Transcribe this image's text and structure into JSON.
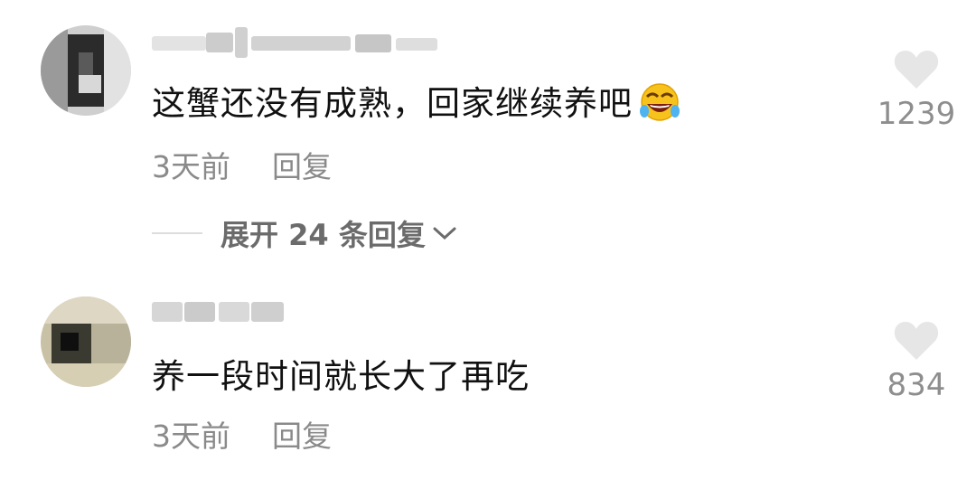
{
  "comments": [
    {
      "text": "这蟹还没有成熟，回家继续养吧",
      "emoji": "rolling-laughing-emoji",
      "time": "3天前",
      "reply_label": "回复",
      "likes": "1239"
    },
    {
      "text": "养一段时间就长大了再吃",
      "time": "3天前",
      "reply_label": "回复",
      "likes": "834"
    }
  ],
  "expand_replies": {
    "label": "展开 24 条回复"
  },
  "colors": {
    "like_heart": "#e6e6e6",
    "meta_text": "#8a8a8a",
    "comment_text": "#111111"
  }
}
